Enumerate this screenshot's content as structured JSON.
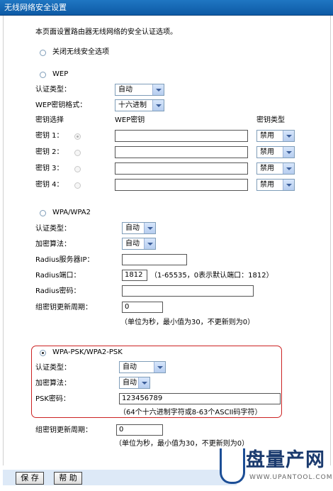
{
  "title": "无线网络安全设置",
  "intro": "本页面设置路由器无线网络的安全认证选项。",
  "security_off": {
    "label": "关闭无线安全选项",
    "selected": false
  },
  "wep": {
    "radio_label": "WEP",
    "selected": false,
    "auth_type_label": "认证类型：",
    "auth_type_value": "自动",
    "key_format_label": "WEP密钥格式：",
    "key_format_value": "十六进制",
    "col_key_select": "密钥选择",
    "col_key": "WEP密钥",
    "col_key_type": "密钥类型",
    "keys": [
      {
        "label": "密钥 1：",
        "selected": true,
        "value": "",
        "type": "禁用"
      },
      {
        "label": "密钥 2：",
        "selected": false,
        "value": "",
        "type": "禁用"
      },
      {
        "label": "密钥 3：",
        "selected": false,
        "value": "",
        "type": "禁用"
      },
      {
        "label": "密钥 4：",
        "selected": false,
        "value": "",
        "type": "禁用"
      }
    ]
  },
  "wpa": {
    "radio_label": "WPA/WPA2",
    "selected": false,
    "auth_type_label": "认证类型：",
    "auth_type_value": "自动",
    "encryption_label": "加密算法：",
    "encryption_value": "自动",
    "radius_ip_label": "Radius服务器IP：",
    "radius_ip_value": "",
    "radius_port_label": "Radius端口：",
    "radius_port_value": "1812",
    "radius_port_hint": "（1-65535，0表示默认端口：1812）",
    "radius_password_label": "Radius密码：",
    "radius_password_value": "",
    "group_key_label": "组密钥更新周期：",
    "group_key_value": "0",
    "group_key_hint": "（单位为秒，最小值为30，不更新则为0）"
  },
  "wpa_psk": {
    "radio_label": "WPA-PSK/WPA2-PSK",
    "selected": true,
    "auth_type_label": "认证类型：",
    "auth_type_value": "自动",
    "encryption_label": "加密算法：",
    "encryption_value": "自动",
    "psk_label": "PSK密码：",
    "psk_value": "123456789",
    "psk_hint": "（64个十六进制字符或8-63个ASCII码字符）",
    "group_key_label": "组密钥更新周期：",
    "group_key_value": "0",
    "group_key_hint": "（单位为秒，最小值为30，不更新则为0）"
  },
  "buttons": {
    "save": "保 存",
    "help": "帮 助"
  },
  "watermark": {
    "brand": "盘量产网",
    "url": "WWW.UPANTOOL.COM"
  },
  "colors": {
    "titlebar": "#0d5aa5",
    "highlight_border": "#cc2222",
    "bottom_bar": "#dde9f7"
  }
}
